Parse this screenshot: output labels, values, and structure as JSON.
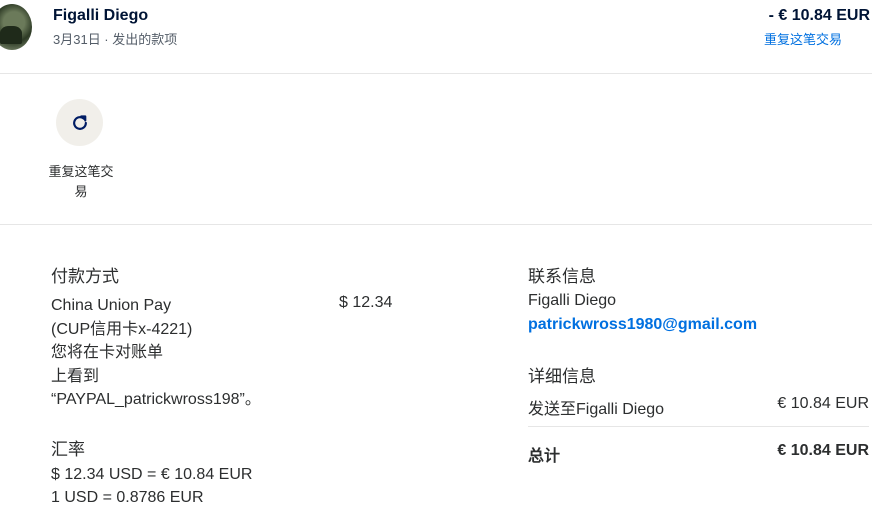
{
  "header": {
    "name": "Figalli Diego",
    "meta": "3月31日 · 发出的款项",
    "amount": "- € 10.84 EUR",
    "repeat_link": "重复这笔交易"
  },
  "action": {
    "icon": "refresh-icon",
    "label": "重复这笔交易"
  },
  "payment_method": {
    "title": "付款方式",
    "lines": [
      "China Union Pay",
      "(CUP信用卡x-4221)",
      "您将在卡对账单",
      "上看到",
      "“PAYPAL_patrickwross198”。"
    ],
    "amount": "$ 12.34"
  },
  "exchange_rate": {
    "title": "汇率",
    "line1": "$ 12.34 USD = € 10.84 EUR",
    "line2": "1 USD = 0.8786 EUR"
  },
  "contact": {
    "title": "联系信息",
    "name": "Figalli Diego",
    "email": "patrickwross1980@gmail.com"
  },
  "details": {
    "title": "详细信息",
    "sent_to_label": "发送至Figalli Diego",
    "sent_to_value": "€ 10.84 EUR",
    "total_label": "总计",
    "total_value": "€ 10.84 EUR"
  },
  "colors": {
    "link": "#0070e0",
    "text": "#2c2e2f",
    "action_bg": "#f1efea",
    "icon": "#001c64"
  }
}
